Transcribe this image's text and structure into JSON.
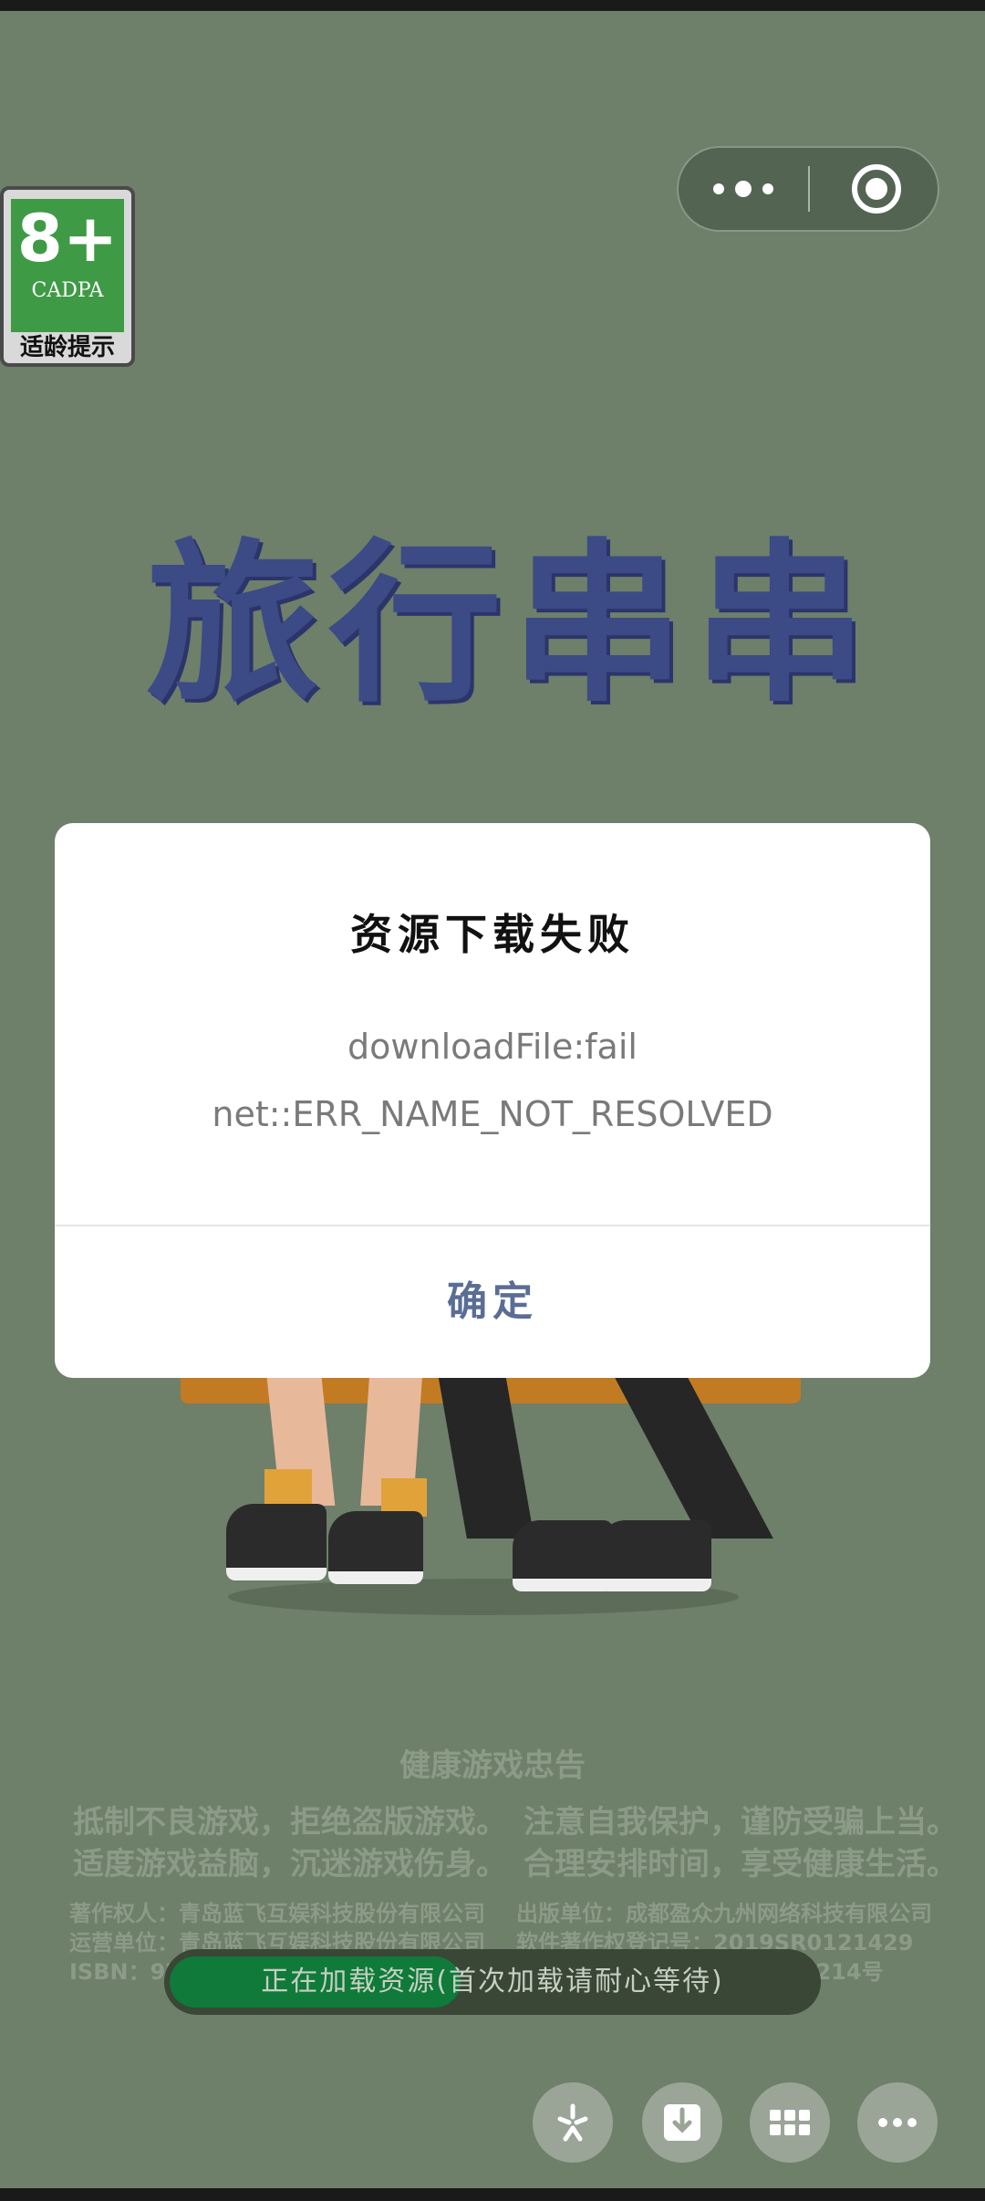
{
  "age_badge": {
    "rating": "8+",
    "org": "CADPA",
    "tip": "适龄提示"
  },
  "capsule": {
    "more_label": "more",
    "close_label": "close"
  },
  "game_title": "旅行串串",
  "health_advisory": {
    "title": "健康游戏忠告",
    "line1_left": "抵制不良游戏，拒绝盗版游戏。",
    "line1_right": "注意自我保护，谨防受骗上当。",
    "line2_left": "适度游戏益脑，沉迷游戏伤身。",
    "line2_right": "合理安排时间，享受健康生活。",
    "copyright": "著作权人：青岛蓝飞互娱科技股份有限公司",
    "publisher": "出版单位：成都盈众九州网络科技有限公司",
    "operator": "运营单位：青岛蓝飞互娱科技股份有限公司",
    "software_reg": "软件著作权登记号：2019SR0121429",
    "isbn": "ISBN：97",
    "approval": "2019]3214号"
  },
  "loading": {
    "text": "正在加载资源(首次加载请耐心等待)",
    "progress": 0.45
  },
  "dialog": {
    "title": "资源下载失败",
    "message_line1": "downloadFile:fail",
    "message_line2": "net::ERR_NAME_NOT_RESOLVED",
    "confirm_label": "确定"
  },
  "bottom_buttons": [
    "sparkle-icon",
    "download-icon",
    "grid-icon",
    "more-icon"
  ]
}
